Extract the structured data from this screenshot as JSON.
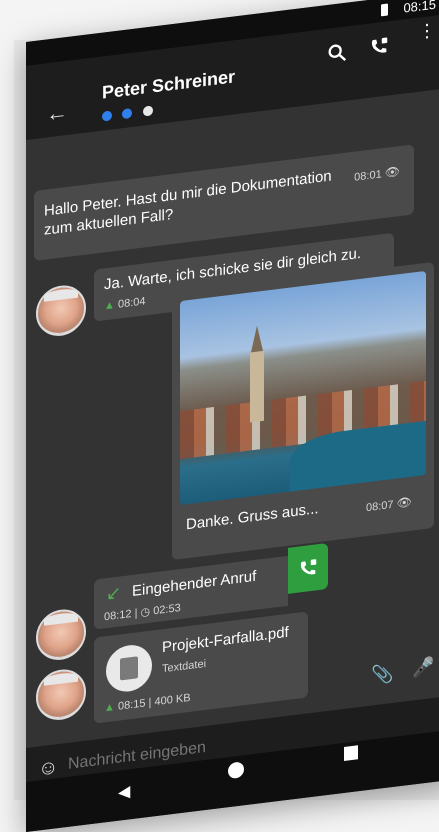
{
  "status": {
    "time": "08:15"
  },
  "header": {
    "contact_name": "Peter Schreiner",
    "presence_dots": [
      "#2f80ed",
      "#2f80ed",
      "#e8e8e8"
    ]
  },
  "messages": [
    {
      "text": "Hallo Peter. Hast du mir die Dokumentation zum aktuellen Fall?",
      "time": "08:01"
    },
    {
      "text": "Ja. Warte, ich schicke sie dir gleich zu.",
      "time": "08:04"
    },
    {
      "caption": "Danke. Gruss aus...",
      "time": "08:07"
    },
    {
      "call_label": "Eingehender Anruf",
      "time": "08:12",
      "duration": "02:53"
    },
    {
      "file_name": "Projekt-Farfalla.pdf",
      "file_type": "Textdatei",
      "time": "08:15",
      "size": "400 KB"
    }
  ],
  "input": {
    "placeholder": "Nachricht eingeben"
  },
  "colors": {
    "accent_green": "#2e9e3e",
    "presence_blue": "#2f80ed"
  }
}
